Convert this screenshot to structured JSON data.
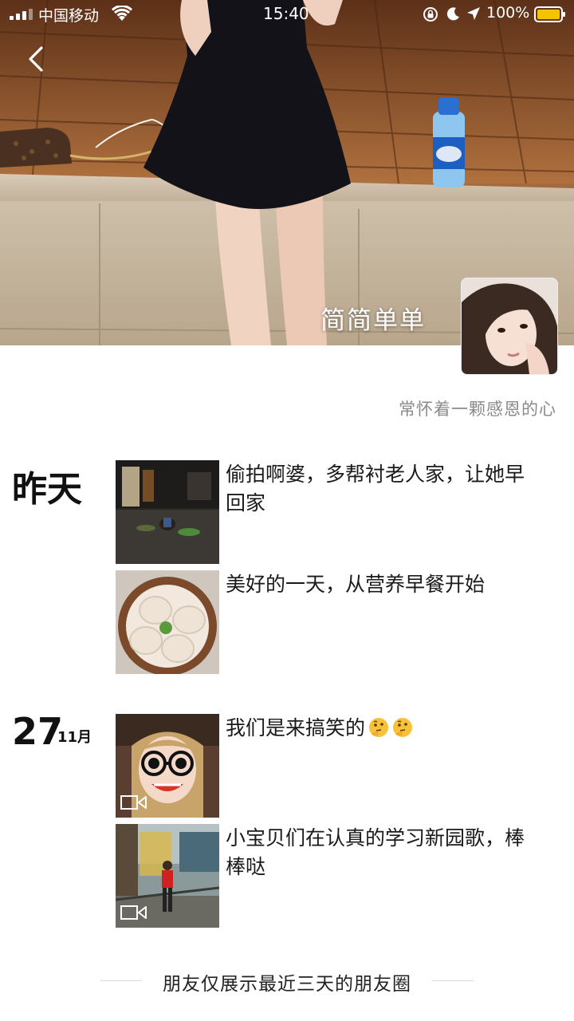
{
  "status_bar": {
    "carrier": "中国移动",
    "time": "15:40",
    "battery": "100%",
    "battery_color": "#f5c400"
  },
  "profile": {
    "cover_name": "简简单单",
    "signature": "常怀着一颗感恩的心"
  },
  "feed": [
    {
      "date_label": "昨天",
      "posts": [
        {
          "text": "偷拍啊婆，多帮衬老人家，让她早回家",
          "media": "photo"
        },
        {
          "text": "美好的一天，从营养早餐开始",
          "media": "photo"
        }
      ]
    },
    {
      "date_day": "27",
      "date_month": "11月",
      "posts": [
        {
          "text": "我们是来搞笑的",
          "emoji": [
            "thinking-face",
            "thinking-face"
          ],
          "media": "video"
        },
        {
          "text": "小宝贝们在认真的学习新园歌，棒棒哒",
          "media": "video"
        }
      ]
    }
  ],
  "footer": {
    "notice": "朋友仅展示最近三天的朋友圈"
  },
  "icons": {
    "back": "chevron-left-icon",
    "video": "video-camera-icon",
    "signal": "signal-bars-icon",
    "wifi": "wifi-icon",
    "lock": "rotation-lock-icon",
    "moon": "do-not-disturb-icon",
    "location": "location-arrow-icon",
    "battery": "battery-icon"
  }
}
